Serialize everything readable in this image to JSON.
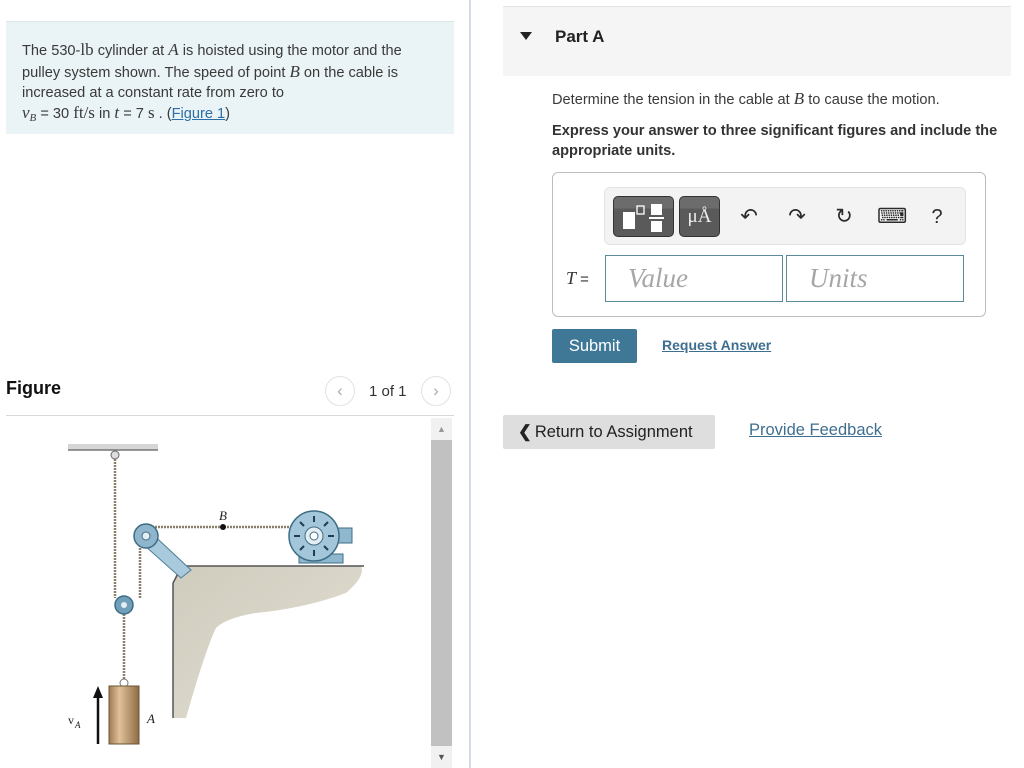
{
  "problem": {
    "text_1": "The 530-",
    "unit_lb": "lb",
    "text_2": " cylinder at ",
    "var_A": "A",
    "text_3": " is hoisted using the motor and the pulley system shown. The speed of point ",
    "var_B": "B",
    "text_4": " on the cable is increased at a constant rate from zero to",
    "vb_var": "v",
    "vb_sub": "B",
    "vb_eq": " = 30 ",
    "vb_unit": "ft/s",
    "text_5": " in ",
    "t_var": "t",
    "t_eq": " = 7 ",
    "t_unit": "s",
    "text_6": " . (",
    "figure_link": "Figure 1",
    "text_7": ")"
  },
  "figure": {
    "title": "Figure",
    "page_indicator": "1 of 1",
    "prev_icon": "chevron-left",
    "next_icon": "chevron-right",
    "labels": {
      "point_b": "B",
      "cylinder": "A",
      "velocity": "v",
      "velocity_sub": "A"
    }
  },
  "part": {
    "title": "Part A",
    "question_1": "Determine the tension in the cable at ",
    "question_var": "B",
    "question_2": " to cause the motion.",
    "instruction": "Express your answer to three significant figures and include the appropriate units."
  },
  "answer": {
    "toolbar": {
      "templates_icon": "templates",
      "units_label": "μÅ",
      "undo_icon": "↶",
      "redo_icon": "↷",
      "reset_icon": "↻",
      "keyboard_icon": "⌨",
      "help_label": "?"
    },
    "variable": "T",
    "equals": " =",
    "value_placeholder": "Value",
    "units_placeholder": "Units"
  },
  "actions": {
    "submit": "Submit",
    "request_answer": "Request Answer",
    "return_chevron": "❮",
    "return_label": "Return to Assignment",
    "feedback": "Provide Feedback"
  },
  "colors": {
    "submit_bg": "#3f7797",
    "link": "#2a6fa8",
    "problem_bg": "#eaf3f5"
  }
}
